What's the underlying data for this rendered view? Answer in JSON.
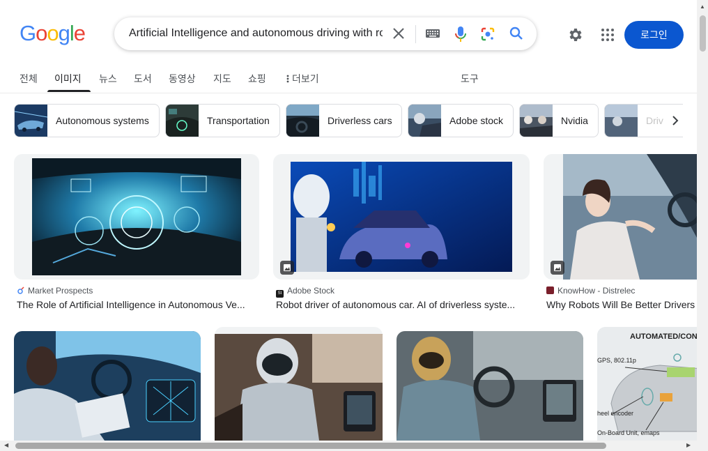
{
  "logo": {
    "letters": [
      "G",
      "o",
      "o",
      "g",
      "l",
      "e"
    ],
    "colors": [
      "#4285f4",
      "#ea4335",
      "#fbbc05",
      "#4285f4",
      "#34a853",
      "#ea4335"
    ]
  },
  "search": {
    "query": "Artificial Intelligence and autonomous driving with ro"
  },
  "header": {
    "login_label": "로그인"
  },
  "tabs": [
    {
      "label": "전체"
    },
    {
      "label": "이미지"
    },
    {
      "label": "뉴스"
    },
    {
      "label": "도서"
    },
    {
      "label": "동영상"
    },
    {
      "label": "지도"
    },
    {
      "label": "쇼핑"
    },
    {
      "label": "더보기"
    },
    {
      "label": "도구"
    }
  ],
  "chips": [
    {
      "label": "Autonomous systems"
    },
    {
      "label": "Transportation"
    },
    {
      "label": "Driverless cars"
    },
    {
      "label": "Adobe stock"
    },
    {
      "label": "Nvidia"
    },
    {
      "label": "Driv"
    }
  ],
  "results": [
    {
      "source": "Market Prospects",
      "title": "The Role of Artificial Intelligence in Autonomous Ve..."
    },
    {
      "source": "Adobe Stock",
      "title": "Robot driver of autonomous car. AI of driverless syste..."
    },
    {
      "source": "KnowHow - Distrelec",
      "title": "Why Robots Will Be Better Drivers"
    }
  ],
  "diagram_thumb": {
    "heading": "AUTOMATED/CONN",
    "label_gps": "GPS, 802.11p",
    "label_wheel": "heel encoder",
    "label_obu": "On-Board Unit, emaps"
  },
  "colors": {
    "accent": "#0b57d0",
    "active_tab": "#202124"
  }
}
